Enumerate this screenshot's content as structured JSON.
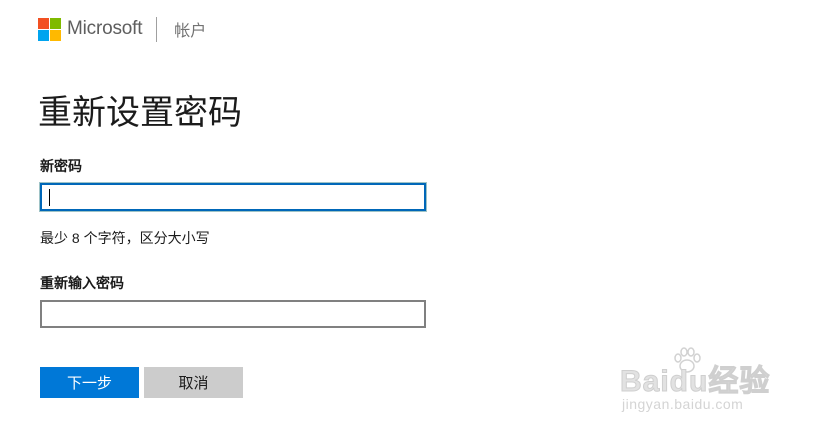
{
  "header": {
    "brand": "Microsoft",
    "section": "帐户",
    "logo_colors": [
      "#f25022",
      "#7fba00",
      "#00a4ef",
      "#ffb900"
    ]
  },
  "page": {
    "title": "重新设置密码"
  },
  "form": {
    "new_password_label": "新密码",
    "new_password_value": "",
    "hint": "最少 8 个字符，区分大小写",
    "confirm_password_label": "重新输入密码",
    "confirm_password_value": ""
  },
  "buttons": {
    "next": "下一步",
    "cancel": "取消"
  },
  "colors": {
    "primary": "#0078d7",
    "secondary": "#cccccc",
    "focus_border": "#0067b8"
  },
  "watermark": {
    "logo_text": "Baidu经验",
    "site": "jingyan.baidu.com"
  }
}
